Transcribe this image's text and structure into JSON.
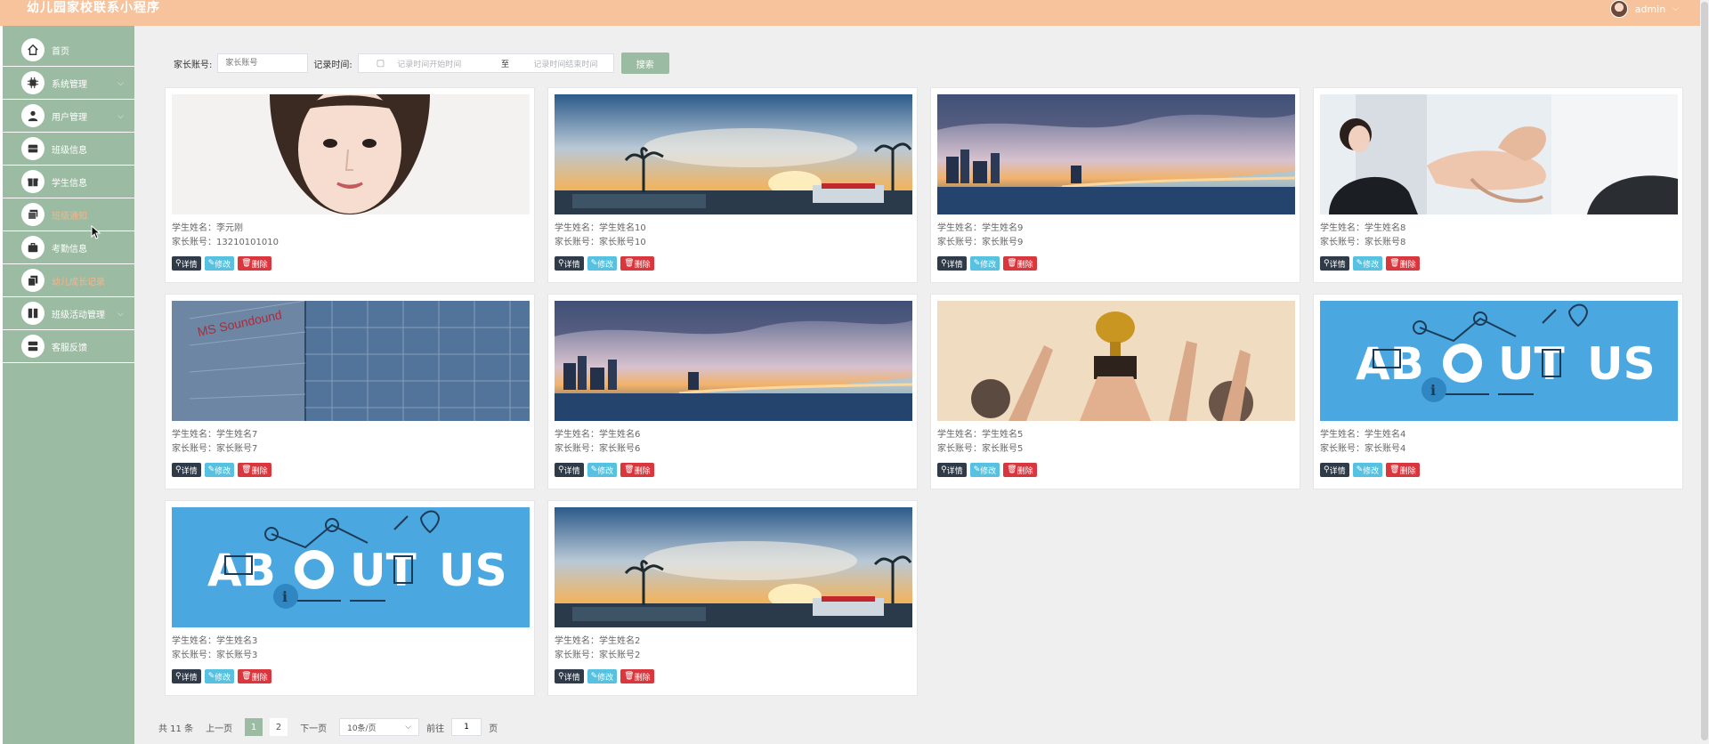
{
  "app": {
    "title": "幼儿园家校联系小程序",
    "user": "admin"
  },
  "sidebar": {
    "items": [
      {
        "label": "首页",
        "icon": "home-icon"
      },
      {
        "label": "系统管理",
        "icon": "chip-icon",
        "arrow": true
      },
      {
        "label": "用户管理",
        "icon": "person-icon",
        "arrow": true
      },
      {
        "label": "班级信息",
        "icon": "ticket-icon"
      },
      {
        "label": "学生信息",
        "icon": "gift-icon"
      },
      {
        "label": "班级通知",
        "icon": "stack-icon",
        "active": true
      },
      {
        "label": "考勤信息",
        "icon": "briefcase-icon"
      },
      {
        "label": "幼儿成长记录",
        "icon": "copy-icon",
        "active": true
      },
      {
        "label": "班级活动管理",
        "icon": "book-icon",
        "arrow": true
      },
      {
        "label": "客服反馈",
        "icon": "server-icon"
      }
    ]
  },
  "search": {
    "parent_label": "家长账号:",
    "parent_placeholder": "家长账号",
    "time_label": "记录时间:",
    "start_placeholder": "记录时间开始时间",
    "sep": "至",
    "end_placeholder": "记录时间结束时间",
    "button": "搜索"
  },
  "buttons": {
    "detail": "详情",
    "edit": "修改",
    "delete": "删除"
  },
  "cards": [
    {
      "student": "学生姓名：李元刚",
      "parent": "家长账号：13210101010",
      "img": "portrait"
    },
    {
      "student": "学生姓名：学生姓名10",
      "parent": "家长账号：家长账号10",
      "img": "sunset"
    },
    {
      "student": "学生姓名：学生姓名9",
      "parent": "家长账号：家长账号9",
      "img": "city"
    },
    {
      "student": "学生姓名：学生姓名8",
      "parent": "家长账号：家长账号8",
      "img": "team"
    },
    {
      "student": "学生姓名：学生姓名7",
      "parent": "家长账号：家长账号7",
      "img": "building"
    },
    {
      "student": "学生姓名：学生姓名6",
      "parent": "家长账号：家长账号6",
      "img": "city"
    },
    {
      "student": "学生姓名：学生姓名5",
      "parent": "家长账号：家长账号5",
      "img": "trophy"
    },
    {
      "student": "学生姓名：学生姓名4",
      "parent": "家长账号：家长账号4",
      "img": "about"
    },
    {
      "student": "学生姓名：学生姓名3",
      "parent": "家长账号：家长账号3",
      "img": "about"
    },
    {
      "student": "学生姓名：学生姓名2",
      "parent": "家长账号：家长账号2",
      "img": "sunset"
    }
  ],
  "pagination": {
    "total": "共 11 条",
    "prev": "上一页",
    "pages": [
      "1",
      "2"
    ],
    "next": "下一页",
    "page_size": "10条/页",
    "goto": "前往",
    "goto_value": "1",
    "page_unit": "页"
  },
  "colors": {
    "topbar": "#f6c39c",
    "sidebar": "#9bbca3",
    "accent": "#f6b48b"
  }
}
